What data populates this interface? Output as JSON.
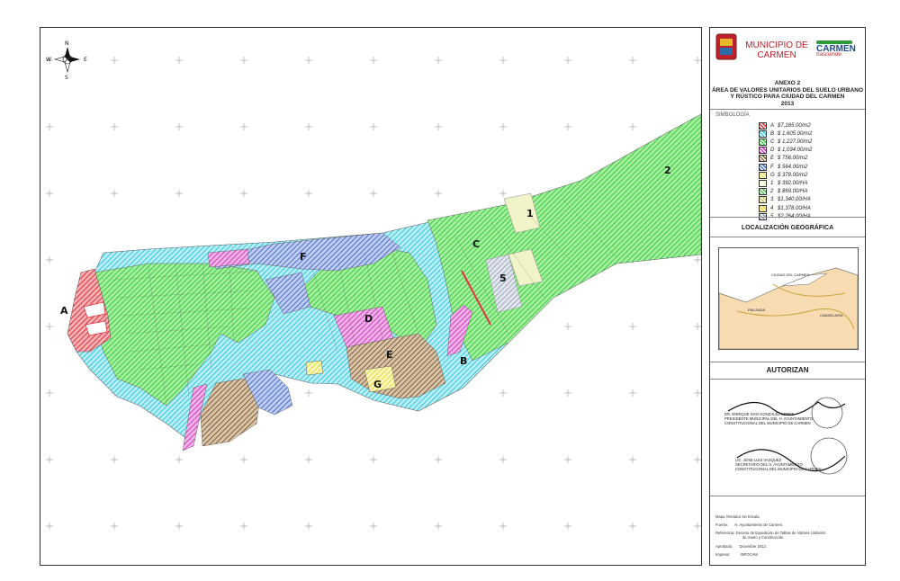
{
  "map": {
    "compass": {
      "n": "N",
      "s": "S",
      "e": "E",
      "w": "W"
    },
    "zone_labels": [
      {
        "id": "A",
        "text": "A"
      },
      {
        "id": "B",
        "text": "B"
      },
      {
        "id": "C",
        "text": "C"
      },
      {
        "id": "D",
        "text": "D"
      },
      {
        "id": "E",
        "text": "E"
      },
      {
        "id": "F",
        "text": "F"
      },
      {
        "id": "G",
        "text": "G"
      },
      {
        "id": "1",
        "text": "1"
      },
      {
        "id": "2",
        "text": "2"
      },
      {
        "id": "5",
        "text": "5"
      }
    ]
  },
  "header": {
    "municipio_line1": "MUNICIPIO DE",
    "municipio_line2": "CARMEN",
    "logo_word": "CARMEN",
    "logo_sub": "trasciende",
    "annex": "ANEXO 2",
    "title_line1": "ÁREA DE VALORES UNITARIOS DEL SUELO URBANO",
    "title_line2": "Y RÚSTICO PARA CIUDAD DEL CARMEN",
    "year": "2013"
  },
  "legend": {
    "heading": "SIMBOLOGÍA",
    "items": [
      {
        "code": "A",
        "value": "$7,165.00/m2",
        "color": "#e0353f"
      },
      {
        "code": "B",
        "value": "$ 1,605.00/m2",
        "color": "#40d2e6"
      },
      {
        "code": "C",
        "value": "$ 1,227.00/m2",
        "color": "#3ed84c"
      },
      {
        "code": "D",
        "value": "$ 1,034.00/m2",
        "color": "#d93ac4"
      },
      {
        "code": "E",
        "value": "$ 756.00/m2",
        "color": "#8a6a44"
      },
      {
        "code": "F",
        "value": "$ 564.00/m2",
        "color": "#4a72cf"
      },
      {
        "code": "G",
        "value": "$ 378.00/m2",
        "color": "#eee85a"
      },
      {
        "code": "1",
        "value": "$ 392.00/HA",
        "color": "#f1f3c8"
      },
      {
        "code": "2",
        "value": "$ 869.00/HA",
        "color": "#56b85a"
      },
      {
        "code": "3",
        "value": "$1,340.00/HA",
        "color": "#c9c56a"
      },
      {
        "code": "4",
        "value": "$1,378.00/HA",
        "color": "#f0d02a"
      },
      {
        "code": "5",
        "value": "$2,264.00/HA",
        "color": "#9aa4b6"
      }
    ]
  },
  "location": {
    "heading": "LOCALIZACIÓN GEOGRÁFICA",
    "places": [
      "CIUDAD DEL CARMEN",
      "PALIZADA",
      "CANDELARIA"
    ]
  },
  "authorize": {
    "heading": "AUTORIZAN",
    "sig1": [
      "DR. ENRIQUE IVAN GONZÁLEZ LÓPEZ",
      "PRESIDENTE MUNICIPAL DEL H. AYUNTAMIENTO",
      "CONSTITUCIONAL DEL MUNICIPIO DE CARMEN"
    ],
    "sig2": [
      "LIC. JOSE LUIS VASQUEZ",
      "SECRETARIO DEL H. AYUNTAMIENTO",
      "CONSTITUCIONAL DEL MUNICIPIO DE CARMEN"
    ]
  },
  "footer": {
    "note": "Mapa Temático sin Escala",
    "fuente_label": "Fuente:",
    "fuente": "H. Ayuntamiento de Carmen.",
    "ref_label": "Referencia:",
    "ref1": "Decreto de Expedición de Tablas de Valores Unitarios",
    "ref2": "de Suelo y Construcción.",
    "aprob_label": "Aprobado:",
    "aprob": "Diciembre 2012.",
    "impreso_label": "Impreso:",
    "impreso": "INFOCAM"
  },
  "colors": {
    "frame": "#333333",
    "accent_green": "#2d9a3a",
    "accent_red": "#c0202a"
  }
}
